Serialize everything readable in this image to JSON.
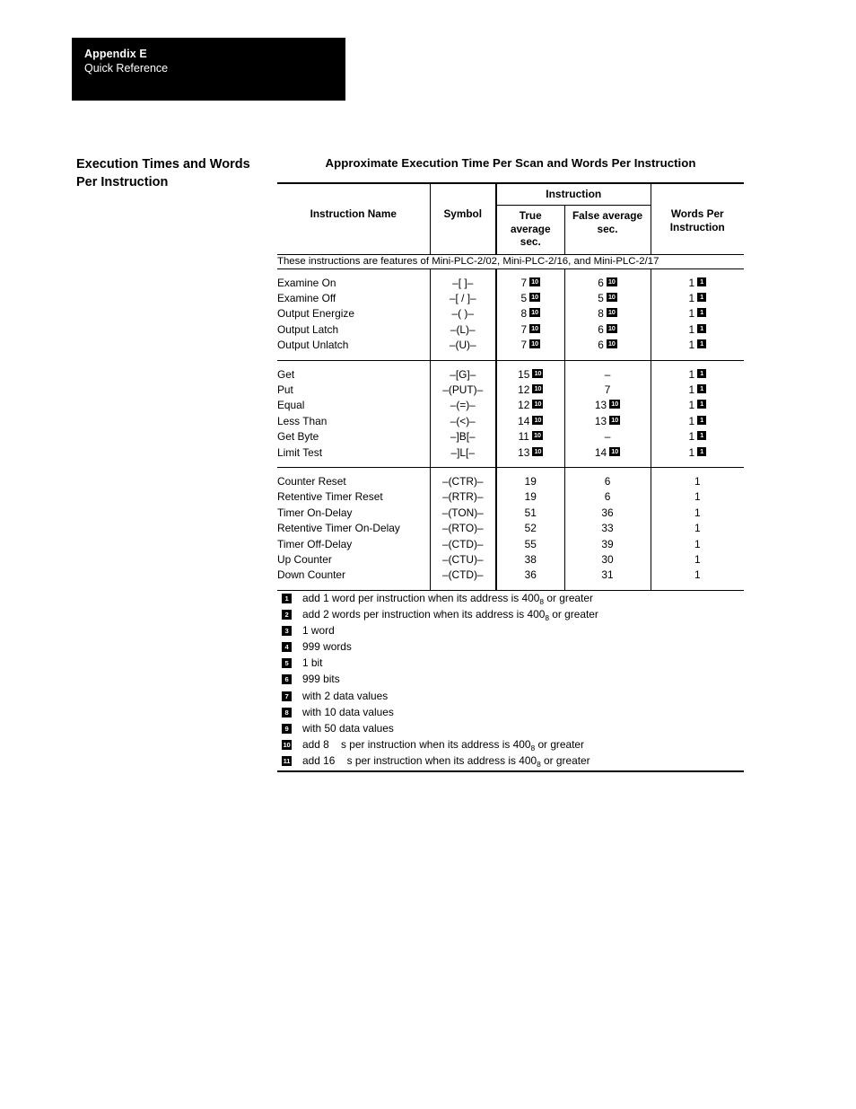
{
  "header": {
    "appendix": "Appendix E",
    "subtitle": "Quick Reference"
  },
  "section": {
    "title_line1": "Execution Times and Words",
    "title_line2": "Per Instruction"
  },
  "table": {
    "caption": "Approximate Execution Time Per Scan and Words Per Instruction",
    "headers": {
      "instruction_name": "Instruction Name",
      "symbol": "Symbol",
      "instruction_group": "Instruction",
      "true_average": "True\naverage\nsec.",
      "true_average_l1": "True",
      "true_average_l2": "average",
      "true_average_l3": "sec.",
      "false_average_l1": "False average",
      "false_average_l2": "sec.",
      "words_per_l1": "Words Per",
      "words_per_l2": "Instruction"
    },
    "note": "These instructions are features of Mini-PLC-2/02, Mini-PLC-2/16, and Mini-PLC-2/17",
    "groups": [
      {
        "rows": [
          {
            "name": "Examine On",
            "symbol": "–[  ]–",
            "true": "7",
            "true_sup": "10",
            "false": "6",
            "false_sup": "10",
            "words": "1",
            "words_sup": "1"
          },
          {
            "name": "Examine Off",
            "symbol": "–[ / ]–",
            "true": "5",
            "true_sup": "10",
            "false": "5",
            "false_sup": "10",
            "words": "1",
            "words_sup": "1"
          },
          {
            "name": "Output Energize",
            "symbol": "–(   )–",
            "true": "8",
            "true_sup": "10",
            "false": "8",
            "false_sup": "10",
            "words": "1",
            "words_sup": "1"
          },
          {
            "name": "Output Latch",
            "symbol": "–(L)–",
            "true": "7",
            "true_sup": "10",
            "false": "6",
            "false_sup": "10",
            "words": "1",
            "words_sup": "1"
          },
          {
            "name": "Output Unlatch",
            "symbol": "–(U)–",
            "true": "7",
            "true_sup": "10",
            "false": "6",
            "false_sup": "10",
            "words": "1",
            "words_sup": "1"
          }
        ]
      },
      {
        "rows": [
          {
            "name": "Get",
            "symbol": "–[G]–",
            "true": "15",
            "true_sup": "10",
            "false": "–",
            "false_sup": "",
            "words": "1",
            "words_sup": "1"
          },
          {
            "name": "Put",
            "symbol": "–(PUT)–",
            "true": "12",
            "true_sup": "10",
            "false": "7",
            "false_sup": "",
            "words": "1",
            "words_sup": "1"
          },
          {
            "name": "Equal",
            "symbol": "–(=)–",
            "true": "12",
            "true_sup": "10",
            "false": "13",
            "false_sup": "10",
            "words": "1",
            "words_sup": "1"
          },
          {
            "name": "Less Than",
            "symbol": "–(<)–",
            "true": "14",
            "true_sup": "10",
            "false": "13",
            "false_sup": "10",
            "words": "1",
            "words_sup": "1"
          },
          {
            "name": "Get Byte",
            "symbol": "–]B[–",
            "true": "11",
            "true_sup": "10",
            "false": "–",
            "false_sup": "",
            "words": "1",
            "words_sup": "1"
          },
          {
            "name": "Limit Test",
            "symbol": "–]L[–",
            "true": "13",
            "true_sup": "10",
            "false": "14",
            "false_sup": "10",
            "words": "1",
            "words_sup": "1"
          }
        ]
      },
      {
        "rows": [
          {
            "name": "Counter Reset",
            "symbol": "–(CTR)–",
            "true": "19",
            "true_sup": "",
            "false": "6",
            "false_sup": "",
            "words": "1",
            "words_sup": ""
          },
          {
            "name": "Retentive Timer Reset",
            "symbol": "–(RTR)–",
            "true": "19",
            "true_sup": "",
            "false": "6",
            "false_sup": "",
            "words": "1",
            "words_sup": ""
          },
          {
            "name": "Timer On-Delay",
            "symbol": "–(TON)–",
            "true": "51",
            "true_sup": "",
            "false": "36",
            "false_sup": "",
            "words": "1",
            "words_sup": ""
          },
          {
            "name": "Retentive Timer On-Delay",
            "symbol": "–(RTO)–",
            "true": "52",
            "true_sup": "",
            "false": "33",
            "false_sup": "",
            "words": "1",
            "words_sup": ""
          },
          {
            "name": "Timer Off-Delay",
            "symbol": "–(CTD)–",
            "true": "55",
            "true_sup": "",
            "false": "39",
            "false_sup": "",
            "words": "1",
            "words_sup": ""
          },
          {
            "name": "Up Counter",
            "symbol": "–(CTU)–",
            "true": "38",
            "true_sup": "",
            "false": "30",
            "false_sup": "",
            "words": "1",
            "words_sup": ""
          },
          {
            "name": "Down Counter",
            "symbol": "–(CTD)–",
            "true": "36",
            "true_sup": "",
            "false": "31",
            "false_sup": "",
            "words": "1",
            "words_sup": ""
          }
        ]
      }
    ]
  },
  "footnotes": [
    {
      "marker": "1",
      "pre": "add 1 word per instruction when its address is 400",
      "sub": "8",
      "post": " or greater"
    },
    {
      "marker": "2",
      "pre": "add 2 words per instruction when its address is 400",
      "sub": "8",
      "post": " or greater"
    },
    {
      "marker": "3",
      "pre": "1 word",
      "sub": "",
      "post": ""
    },
    {
      "marker": "4",
      "pre": "999 words",
      "sub": "",
      "post": ""
    },
    {
      "marker": "5",
      "pre": "1 bit",
      "sub": "",
      "post": ""
    },
    {
      "marker": "6",
      "pre": "999 bits",
      "sub": "",
      "post": ""
    },
    {
      "marker": "7",
      "pre": "with 2 data values",
      "sub": "",
      "post": ""
    },
    {
      "marker": "8",
      "pre": "with 10 data values",
      "sub": "",
      "post": ""
    },
    {
      "marker": "9",
      "pre": "with 50 data values",
      "sub": "",
      "post": ""
    },
    {
      "marker": "10",
      "pre": "add 8    s per instruction when its address is 400",
      "sub": "8",
      "post": " or greater"
    },
    {
      "marker": "11",
      "pre": "add 16    s per instruction when its address is 400",
      "sub": "8",
      "post": " or greater"
    }
  ]
}
